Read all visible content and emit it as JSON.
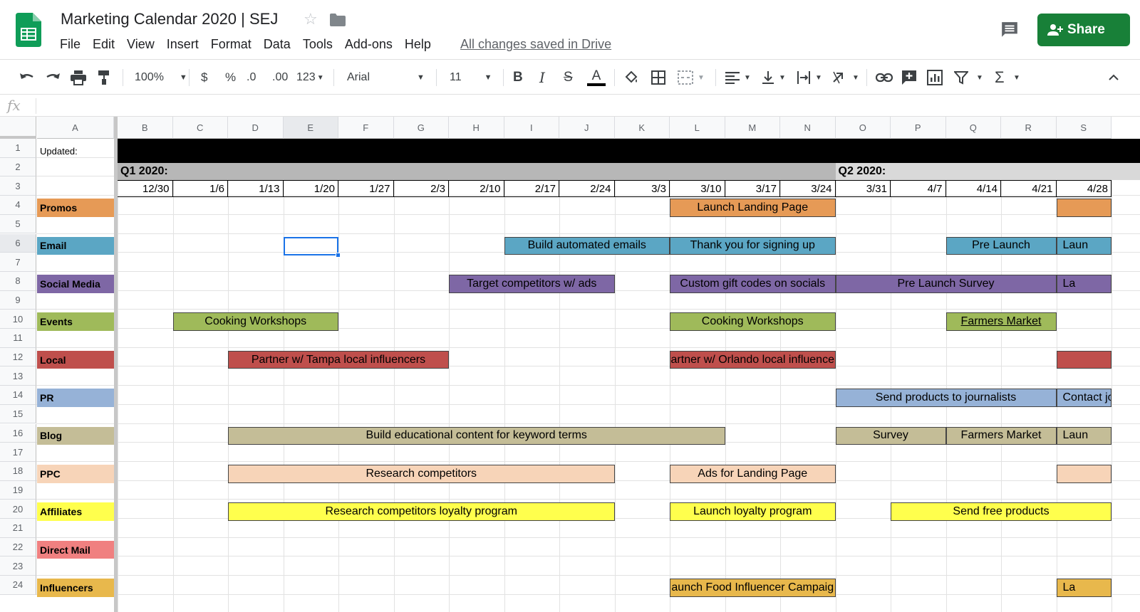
{
  "app": {
    "title": "Marketing Calendar 2020 | SEJ",
    "menu": [
      "File",
      "Edit",
      "View",
      "Insert",
      "Format",
      "Data",
      "Tools",
      "Add-ons",
      "Help"
    ],
    "save_status": "All changes saved in Drive",
    "share_label": "Share",
    "logo_color": "#0f9d58",
    "share_color": "#188038"
  },
  "toolbar": {
    "zoom": "100%",
    "currency": "$",
    "percent": "%",
    "decrease_decimal": ".0",
    "increase_decimal": ".00",
    "more_formats": "123",
    "font": "Arial",
    "font_size": "11",
    "bold": "B",
    "italic": "I",
    "strike": "S",
    "text_color": "A"
  },
  "formula_bar": {
    "fx": "fx",
    "value": ""
  },
  "columns": [
    "A",
    "B",
    "C",
    "D",
    "E",
    "F",
    "G",
    "H",
    "I",
    "J",
    "K",
    "L",
    "M",
    "N",
    "O",
    "P",
    "Q",
    "R",
    "S"
  ],
  "rows": [
    "1",
    "2",
    "3",
    "4",
    "5",
    "6",
    "7",
    "8",
    "9",
    "10",
    "11",
    "12",
    "13",
    "14",
    "15",
    "16",
    "17",
    "18",
    "19",
    "20",
    "21",
    "22",
    "23",
    "24"
  ],
  "selected_cell": "E6",
  "sheet": {
    "updated_label": "Updated:",
    "quarters": [
      {
        "label": "Q1 2020:",
        "color": "#b7b7b7"
      },
      {
        "label": "Q2 2020:",
        "color": "#d9d9d9"
      }
    ],
    "week_dates": [
      "12/30",
      "1/6",
      "1/13",
      "1/20",
      "1/27",
      "2/3",
      "2/10",
      "2/17",
      "2/24",
      "3/3",
      "3/10",
      "3/17",
      "3/24",
      "3/31",
      "4/7",
      "4/14",
      "4/21",
      "4/28"
    ],
    "categories": [
      {
        "label": "Promos",
        "row": 4,
        "color": "#e69a56"
      },
      {
        "label": "Email",
        "row": 6,
        "color": "#5ba6c4"
      },
      {
        "label": "Social Media",
        "row": 8,
        "color": "#7e67a5"
      },
      {
        "label": "Events",
        "row": 10,
        "color": "#9fba5a"
      },
      {
        "label": "Local",
        "row": 12,
        "color": "#bf4f4c"
      },
      {
        "label": "PR",
        "row": 14,
        "color": "#96b2d7"
      },
      {
        "label": "Blog",
        "row": 16,
        "color": "#c4bd97"
      },
      {
        "label": "PPC",
        "row": 18,
        "color": "#f7d4b8"
      },
      {
        "label": "Affiliates",
        "row": 20,
        "color": "#ffff4d"
      },
      {
        "label": "Direct Mail",
        "row": 22,
        "color": "#f08080"
      },
      {
        "label": "Influencers",
        "row": 24,
        "color": "#e8b84c"
      }
    ],
    "activities": [
      {
        "text": "Launch Landing Page",
        "row": 4,
        "start_col": "L",
        "end_col": "N",
        "color": "#e69a56"
      },
      {
        "text": "",
        "row": 4,
        "start_col": "S",
        "end_col": "S",
        "color": "#e69a56"
      },
      {
        "text": "Build automated emails",
        "row": 6,
        "start_col": "I",
        "end_col": "K",
        "color": "#5ba6c4"
      },
      {
        "text": "Thank you for signing up",
        "row": 6,
        "start_col": "L",
        "end_col": "N",
        "color": "#5ba6c4"
      },
      {
        "text": "Pre Launch",
        "row": 6,
        "start_col": "Q",
        "end_col": "R",
        "color": "#5ba6c4"
      },
      {
        "text": "Laun",
        "row": 6,
        "start_col": "S",
        "end_col": "S",
        "color": "#5ba6c4"
      },
      {
        "text": "Target competitors w/ ads",
        "row": 8,
        "start_col": "H",
        "end_col": "J",
        "color": "#7e67a5"
      },
      {
        "text": "Custom gift codes on socials",
        "row": 8,
        "start_col": "L",
        "end_col": "N",
        "color": "#7e67a5"
      },
      {
        "text": "Pre Launch Survey",
        "row": 8,
        "start_col": "O",
        "end_col": "R",
        "color": "#7e67a5"
      },
      {
        "text": "La",
        "row": 8,
        "start_col": "S",
        "end_col": "S",
        "color": "#7e67a5"
      },
      {
        "text": "Cooking Workshops",
        "row": 10,
        "start_col": "C",
        "end_col": "E",
        "color": "#9fba5a"
      },
      {
        "text": "Cooking Workshops",
        "row": 10,
        "start_col": "L",
        "end_col": "N",
        "color": "#9fba5a"
      },
      {
        "text": "Farmers Market",
        "row": 10,
        "start_col": "Q",
        "end_col": "R",
        "color": "#9fba5a",
        "underline": true
      },
      {
        "text": "Partner w/ Tampa local influencers",
        "row": 12,
        "start_col": "D",
        "end_col": "G",
        "color": "#bf4f4c"
      },
      {
        "text": "artner w/ Orlando local influence",
        "row": 12,
        "start_col": "L",
        "end_col": "N",
        "color": "#bf4f4c"
      },
      {
        "text": "",
        "row": 12,
        "start_col": "S",
        "end_col": "S",
        "color": "#bf4f4c"
      },
      {
        "text": "Send products to journalists",
        "row": 14,
        "start_col": "O",
        "end_col": "R",
        "color": "#96b2d7"
      },
      {
        "text": "Contact jo",
        "row": 14,
        "start_col": "S",
        "end_col": "S",
        "color": "#96b2d7"
      },
      {
        "text": "Build educational content for keyword terms",
        "row": 16,
        "start_col": "D",
        "end_col": "L",
        "color": "#c4bd97"
      },
      {
        "text": "Survey",
        "row": 16,
        "start_col": "O",
        "end_col": "P",
        "color": "#c4bd97"
      },
      {
        "text": "Farmers Market",
        "row": 16,
        "start_col": "Q",
        "end_col": "R",
        "color": "#c4bd97"
      },
      {
        "text": "Laun",
        "row": 16,
        "start_col": "S",
        "end_col": "S",
        "color": "#c4bd97"
      },
      {
        "text": "Research competitors",
        "row": 18,
        "start_col": "D",
        "end_col": "J",
        "color": "#f7d4b8"
      },
      {
        "text": "Ads for Landing Page",
        "row": 18,
        "start_col": "L",
        "end_col": "N",
        "color": "#f7d4b8"
      },
      {
        "text": "",
        "row": 18,
        "start_col": "S",
        "end_col": "S",
        "color": "#f7d4b8"
      },
      {
        "text": "Research competitors loyalty program",
        "row": 20,
        "start_col": "D",
        "end_col": "J",
        "color": "#ffff4d"
      },
      {
        "text": "Launch loyalty program",
        "row": 20,
        "start_col": "L",
        "end_col": "N",
        "color": "#ffff4d"
      },
      {
        "text": "Send free products",
        "row": 20,
        "start_col": "P",
        "end_col": "S",
        "color": "#ffff4d"
      },
      {
        "text": "aunch Food Influencer Campaig",
        "row": 24,
        "start_col": "L",
        "end_col": "N",
        "color": "#e8b84c"
      },
      {
        "text": "La",
        "row": 24,
        "start_col": "S",
        "end_col": "S",
        "color": "#e8b84c"
      }
    ]
  }
}
